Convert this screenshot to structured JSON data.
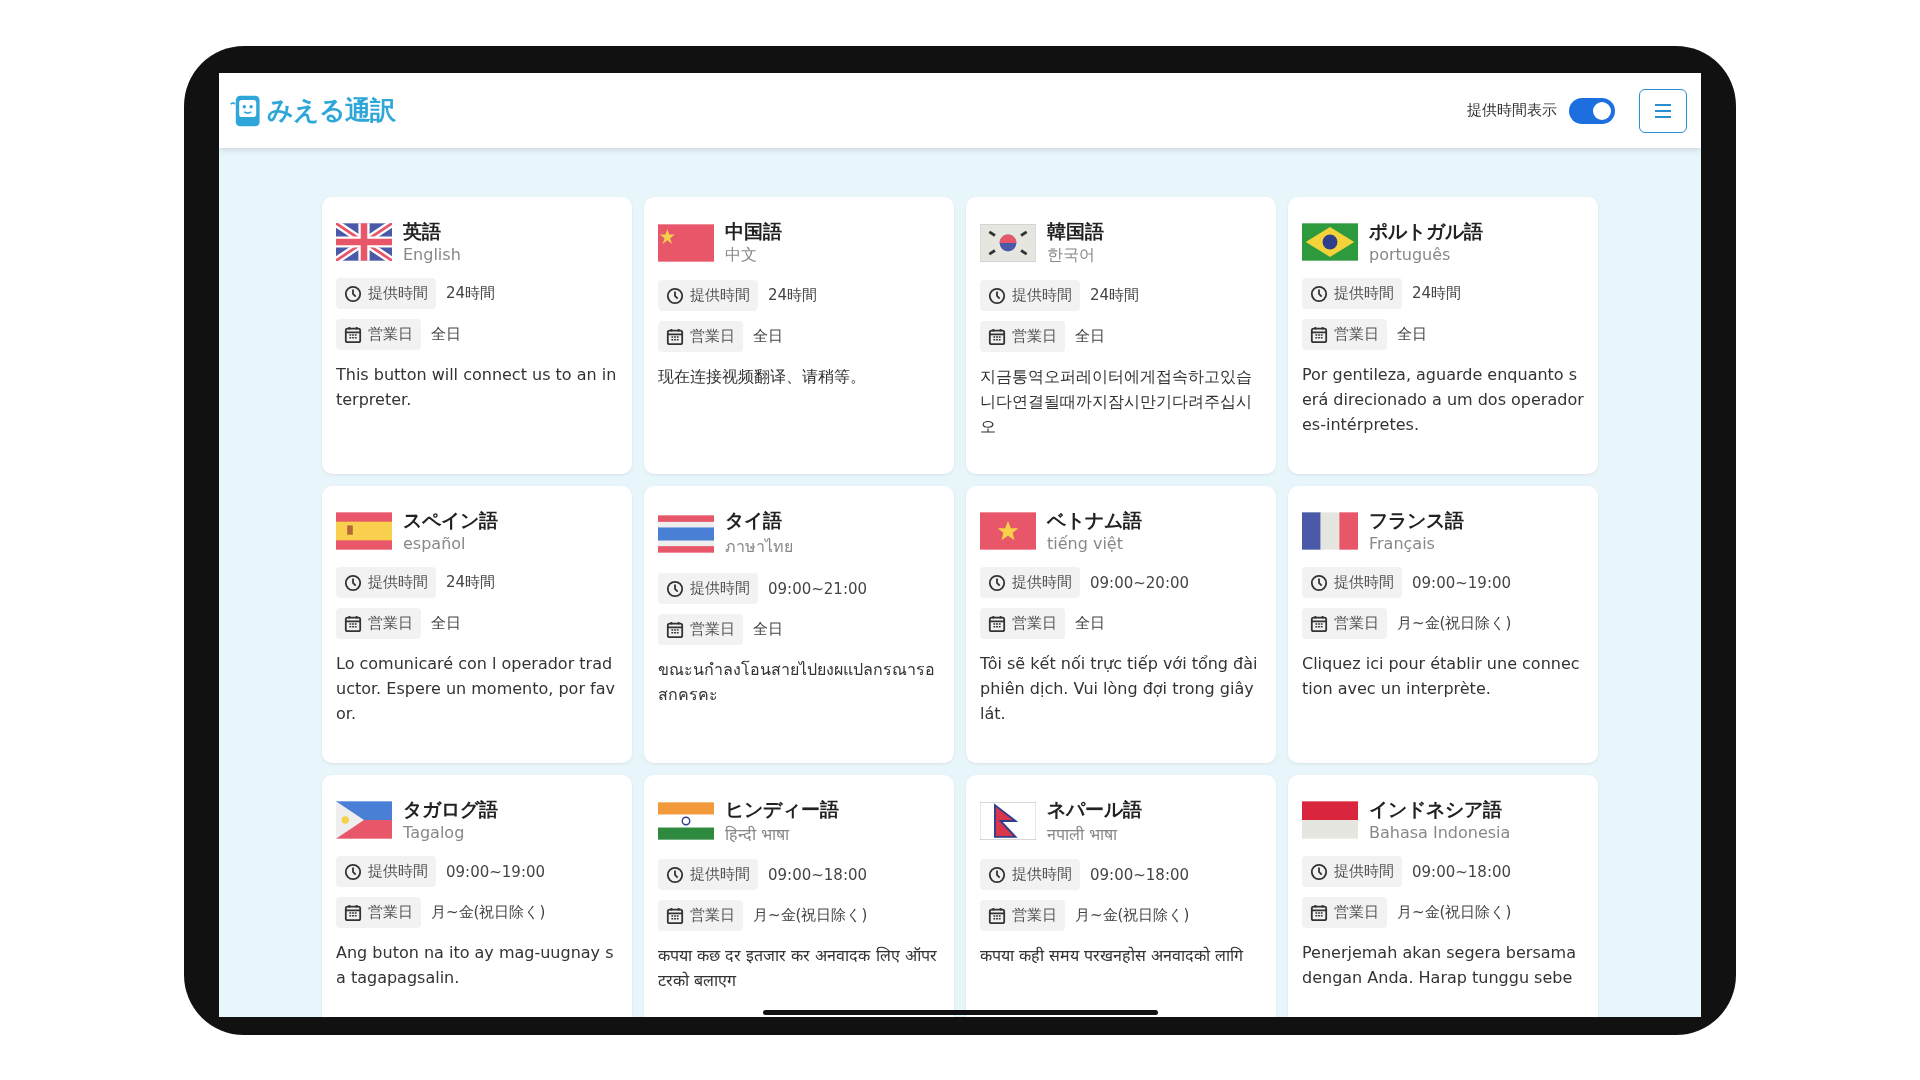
{
  "header": {
    "logo_text": "みえる通訳",
    "toggle": {
      "label": "提供時間表示",
      "on": true
    }
  },
  "languages": [
    {
      "kind": "gb",
      "name": "英語",
      "native": "English",
      "hours_label": "提供時間",
      "hours": "24時間",
      "days_label": "営業日",
      "days": "全日",
      "message": "This button will connect us to an interpreter."
    },
    {
      "kind": "cn",
      "name": "中国語",
      "native": "中文",
      "hours_label": "提供時間",
      "hours": "24時間",
      "days_label": "営業日",
      "days": "全日",
      "message": "现在连接视频翻译、请稍等。"
    },
    {
      "kind": "kr",
      "name": "韓国語",
      "native": "한국어",
      "hours_label": "提供時間",
      "hours": "24時間",
      "days_label": "営業日",
      "days": "全日",
      "message": "지금통역오퍼레이터에게접속하고있습니다연결될때까지잠시만기다려주십시오"
    },
    {
      "kind": "br",
      "name": "ポルトガル語",
      "native": "português",
      "hours_label": "提供時間",
      "hours": "24時間",
      "days_label": "営業日",
      "days": "全日",
      "message": "Por gentileza, aguarde enquanto será direcionado a um dos operadores-intérpretes."
    },
    {
      "kind": "es",
      "name": "スペイン語",
      "native": "español",
      "hours_label": "提供時間",
      "hours": "24時間",
      "days_label": "営業日",
      "days": "全日",
      "message": "Lo comunicaré con l operador traductor. Espere un momento, por favor."
    },
    {
      "kind": "th",
      "name": "タイ語",
      "native": "ภาษาไทย",
      "hours_label": "提供時間",
      "hours": "09:00~21:00",
      "days_label": "営業日",
      "days": "全日",
      "message": "ขณะนกำลงโอนสายไปยงผแปลกรณารอสกครคะ"
    },
    {
      "kind": "vn",
      "name": "ベトナム語",
      "native": "tiếng việt",
      "hours_label": "提供時間",
      "hours": "09:00~20:00",
      "days_label": "営業日",
      "days": "全日",
      "message": "Tôi sẽ kết nối trực tiếp với tổng đài phiên dịch. Vui lòng đợi trong giây lát."
    },
    {
      "kind": "fr",
      "name": "フランス語",
      "native": "Français",
      "hours_label": "提供時間",
      "hours": "09:00~19:00",
      "days_label": "営業日",
      "days": "月~金(祝日除く)",
      "message": "Cliquez ici pour établir une connection avec un interprète."
    },
    {
      "kind": "ph",
      "name": "タガログ語",
      "native": "Tagalog",
      "hours_label": "提供時間",
      "hours": "09:00~19:00",
      "days_label": "営業日",
      "days": "月~金(祝日除く)",
      "message": "Ang buton na ito ay mag-uugnay sa tagapagsalin."
    },
    {
      "kind": "in",
      "name": "ヒンディー語",
      "native": "हिन्दी भाषा",
      "hours_label": "提供時間",
      "hours": "09:00~18:00",
      "days_label": "営業日",
      "days": "月~金(祝日除く)",
      "message": "कपया कछ दर इतजार कर अनवादक लिए ऑपरटरको बलाएग"
    },
    {
      "kind": "np",
      "name": "ネパール語",
      "native": "नपाली भाषा",
      "hours_label": "提供時間",
      "hours": "09:00~18:00",
      "days_label": "営業日",
      "days": "月~金(祝日除く)",
      "message": "कपया कही समय परखनहोस अनवादको लागि"
    },
    {
      "kind": "id",
      "name": "インドネシア語",
      "native": "Bahasa Indonesia",
      "hours_label": "提供時間",
      "hours": "09:00~18:00",
      "days_label": "営業日",
      "days": "月~金(祝日除く)",
      "message": "Penerjemah akan segera bersama dengan Anda. Harap tunggu sebe"
    }
  ]
}
